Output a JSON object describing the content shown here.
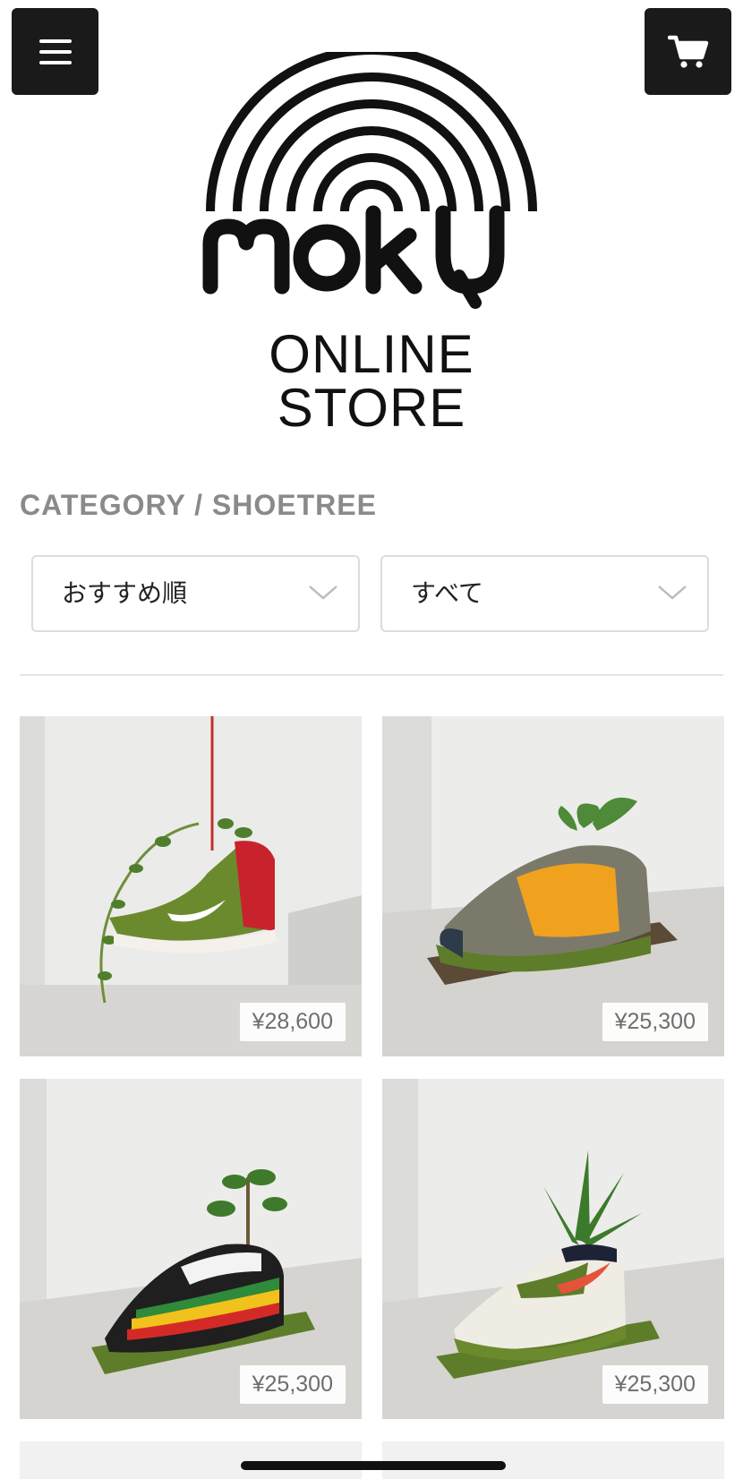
{
  "header": {
    "menu_icon": "hamburger-menu-icon",
    "cart_icon": "shopping-cart-icon"
  },
  "logo": {
    "brand": "MOKU",
    "subtitle": "ONLINE STORE"
  },
  "category": {
    "title": "CATEGORY / SHOETREE"
  },
  "filters": {
    "sort_selected": "おすすめ順",
    "category_selected": "すべて"
  },
  "products": [
    {
      "price": "¥28,600"
    },
    {
      "price": "¥25,300"
    },
    {
      "price": "¥25,300"
    },
    {
      "price": "¥25,300"
    }
  ],
  "colors": {
    "header_button_bg": "#1a1a1a",
    "category_title": "#8a8a8a",
    "moss_green": "#5e7d2a"
  }
}
